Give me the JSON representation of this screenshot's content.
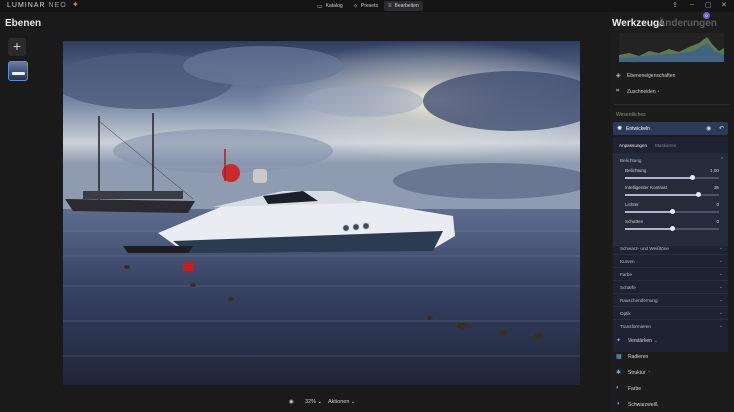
{
  "app": {
    "logo_main": "LUMINAR",
    "logo_sub": "NEO"
  },
  "nav": [
    {
      "label": "Katalog",
      "icon": "folder-icon"
    },
    {
      "label": "Presets",
      "icon": "presets-icon"
    },
    {
      "label": "Bearbeiten",
      "icon": "sliders-icon",
      "active": true
    }
  ],
  "layers": {
    "title": "Ebenen",
    "add_label": "+"
  },
  "bottom": {
    "zoom": "32%",
    "actions": "Aktionen"
  },
  "right": {
    "tab_tools": "Werkzeuge",
    "tab_changes": "Änderungen",
    "badge": "0",
    "layer_props": "Ebeneneigenschaften",
    "crop": "Zuschneiden",
    "section": "Wesentliches",
    "develop": "Entwickeln",
    "subtab_adjust": "Anpassungen",
    "subtab_mask": "Maskieren",
    "exposure_header": "Belichtung",
    "sliders": [
      {
        "label": "Belichtung",
        "value": "1,00",
        "pos": 0.72
      },
      {
        "label": "Intelligenter Kontrast",
        "value": "35",
        "pos": 0.78
      },
      {
        "label": "Lichter",
        "value": "0",
        "pos": 0.5
      },
      {
        "label": "Schatten",
        "value": "0",
        "pos": 0.5
      }
    ],
    "collapsed": [
      "Schwarz- und Weißtöne",
      "Kurven",
      "Farbe",
      "Schärfe",
      "Rauschentfernung",
      "Optik",
      "Transformieren"
    ],
    "tools": [
      {
        "label": "Verstärken",
        "icon": "enhance-icon",
        "arrow": true
      },
      {
        "label": "Radieren",
        "icon": "erase-icon",
        "arrow": false
      },
      {
        "label": "Struktur",
        "icon": "structure-icon",
        "arrow": true
      },
      {
        "label": "Farbe",
        "icon": "color-icon",
        "arrow": false
      },
      {
        "label": "Schwarzweiß",
        "icon": "bw-icon",
        "arrow": false
      }
    ]
  },
  "colors": {
    "accent": "#5a8cd8",
    "develop_bg": "#2c3a5a",
    "badge": "#7a5cd6"
  }
}
